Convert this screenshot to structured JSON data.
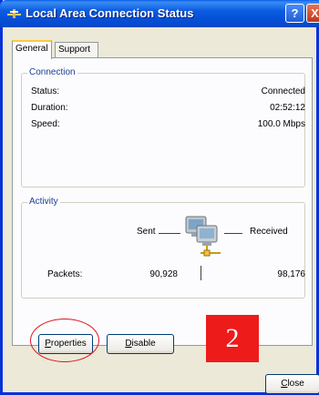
{
  "window": {
    "title": "Local Area Connection Status",
    "help_label": "?",
    "close_label": "X"
  },
  "tabs": [
    {
      "label": "General",
      "active": true
    },
    {
      "label": "Support",
      "active": false
    }
  ],
  "connection": {
    "group_title": "Connection",
    "status_label": "Status:",
    "status_value": "Connected",
    "duration_label": "Duration:",
    "duration_value": "02:52:12",
    "speed_label": "Speed:",
    "speed_value": "100.0 Mbps"
  },
  "activity": {
    "group_title": "Activity",
    "sent_label": "Sent",
    "received_label": "Received",
    "packets_label": "Packets:",
    "packets_sent": "90,928",
    "packets_received": "98,176"
  },
  "buttons": {
    "properties": {
      "prefix": "",
      "accel": "P",
      "rest": "roperties"
    },
    "disable": {
      "prefix": "",
      "accel": "D",
      "rest": "isable"
    },
    "close": {
      "prefix": "",
      "accel": "C",
      "rest": "lose"
    }
  },
  "annotation": {
    "step_number": "2",
    "highlight_color": "#E0141E",
    "badge_color": "#EE1B1B"
  },
  "colors": {
    "titlebar": "#0B5BE0",
    "window_border": "#0831D9",
    "dialog_bg": "#ECE9D8",
    "group_title": "#1C3F95"
  },
  "icons": {
    "title": "network-connection-icon",
    "activity": "network-computers-icon"
  }
}
